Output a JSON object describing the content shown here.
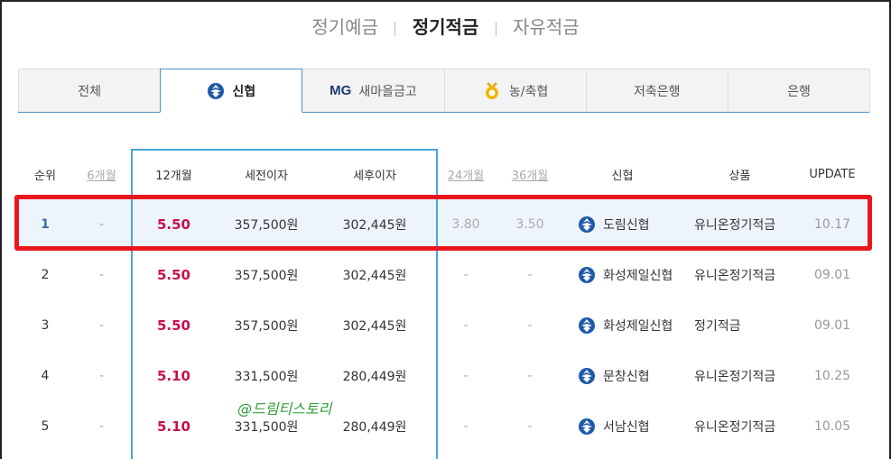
{
  "category_nav": {
    "items": [
      {
        "label": "정기예금",
        "active": false
      },
      {
        "label": "정기적금",
        "active": true
      },
      {
        "label": "자유적금",
        "active": false
      }
    ]
  },
  "tabs": [
    {
      "label": "전체",
      "icon": "",
      "active": false
    },
    {
      "label": "신협",
      "icon": "shinhyup-logo-icon",
      "active": true
    },
    {
      "label": "새마을금고",
      "icon": "mg-logo-icon",
      "prefix": "MG",
      "active": false
    },
    {
      "label": "농/축협",
      "icon": "nonghyup-logo-icon",
      "active": false
    },
    {
      "label": "저축은행",
      "icon": "",
      "active": false
    },
    {
      "label": "은행",
      "icon": "",
      "active": false
    }
  ],
  "table": {
    "headers": {
      "rank": "순위",
      "m6": "6개월",
      "m12": "12개월",
      "pretax": "세전이자",
      "posttax": "세후이자",
      "m24": "24개월",
      "m36": "36개월",
      "bank": "신협",
      "product": "상품",
      "update": "UPDATE"
    },
    "rows": [
      {
        "rank": "1",
        "m6": "-",
        "m12": "5.50",
        "pretax": "357,500원",
        "posttax": "302,445원",
        "m24": "3.80",
        "m36": "3.50",
        "bank": "도림신협",
        "product": "유니온정기적금",
        "update": "10.17"
      },
      {
        "rank": "2",
        "m6": "-",
        "m12": "5.50",
        "pretax": "357,500원",
        "posttax": "302,445원",
        "m24": "-",
        "m36": "-",
        "bank": "화성제일신협",
        "product": "유니온정기적금",
        "update": "09.01"
      },
      {
        "rank": "3",
        "m6": "-",
        "m12": "5.50",
        "pretax": "357,500원",
        "posttax": "302,445원",
        "m24": "-",
        "m36": "-",
        "bank": "화성제일신협",
        "product": "정기적금",
        "update": "09.01"
      },
      {
        "rank": "4",
        "m6": "-",
        "m12": "5.10",
        "pretax": "331,500원",
        "posttax": "280,449원",
        "m24": "-",
        "m36": "-",
        "bank": "문창신협",
        "product": "유니온정기적금",
        "update": "10.25"
      },
      {
        "rank": "5",
        "m6": "-",
        "m12": "5.10",
        "pretax": "331,500원",
        "posttax": "280,449원",
        "m24": "-",
        "m36": "-",
        "bank": "서남신협",
        "product": "유니온정기적금",
        "update": "10.05"
      }
    ]
  },
  "watermark": "@드림티스토리",
  "colors": {
    "rate": "#c8104f",
    "highlight_box": "#e8171d",
    "column_box": "#4aa3e0",
    "active_tab_border": "#4a8fc7",
    "watermark": "#2e9e3a"
  }
}
